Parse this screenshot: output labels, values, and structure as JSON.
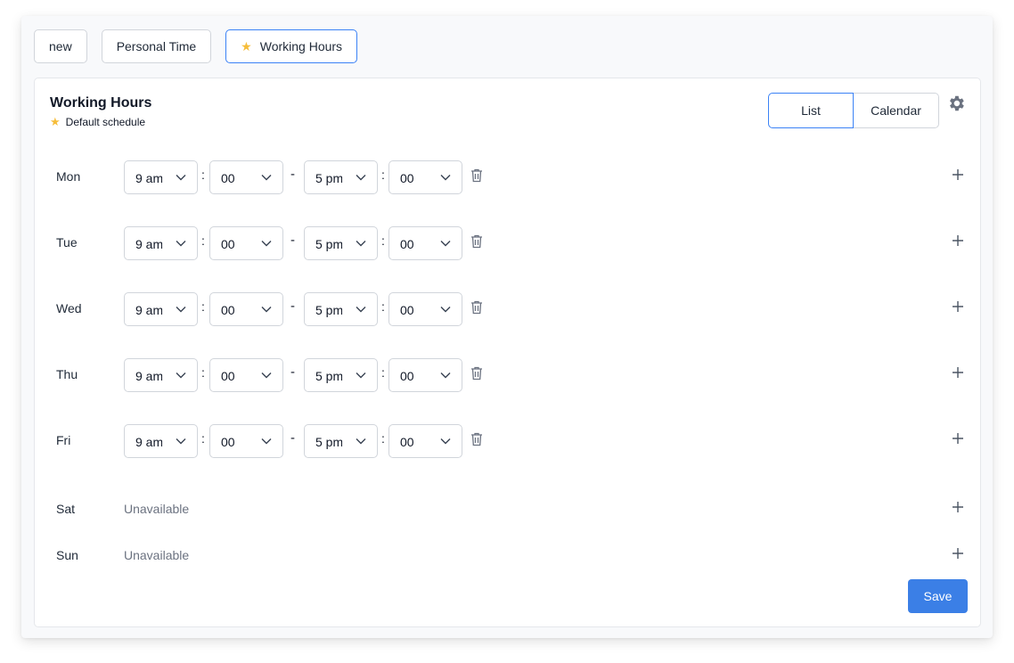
{
  "tabs": [
    {
      "label": "new",
      "active": false,
      "starred": false
    },
    {
      "label": "Personal Time",
      "active": false,
      "starred": false
    },
    {
      "label": "Working Hours",
      "active": true,
      "starred": true
    }
  ],
  "schedule": {
    "title": "Working Hours",
    "subtitle": "Default schedule",
    "view_options": {
      "list": "List",
      "calendar": "Calendar",
      "selected": "List"
    },
    "icons": {
      "star": "★",
      "settings": "gear-icon",
      "delete": "trash-icon",
      "add": "plus-icon"
    },
    "days": [
      {
        "day": "Mon",
        "available": true,
        "start_hour": "9 am",
        "start_min": "00",
        "end_hour": "5 pm",
        "end_min": "00"
      },
      {
        "day": "Tue",
        "available": true,
        "start_hour": "9 am",
        "start_min": "00",
        "end_hour": "5 pm",
        "end_min": "00"
      },
      {
        "day": "Wed",
        "available": true,
        "start_hour": "9 am",
        "start_min": "00",
        "end_hour": "5 pm",
        "end_min": "00"
      },
      {
        "day": "Thu",
        "available": true,
        "start_hour": "9 am",
        "start_min": "00",
        "end_hour": "5 pm",
        "end_min": "00"
      },
      {
        "day": "Fri",
        "available": true,
        "start_hour": "9 am",
        "start_min": "00",
        "end_hour": "5 pm",
        "end_min": "00"
      },
      {
        "day": "Sat",
        "available": false,
        "status": "Unavailable"
      },
      {
        "day": "Sun",
        "available": false,
        "status": "Unavailable"
      }
    ],
    "separator_colon": ":",
    "separator_dash": "-",
    "save_label": "Save"
  },
  "colors": {
    "accent": "#3b7fe6",
    "active_border": "#3b82f6",
    "star": "#f6bd3a"
  }
}
